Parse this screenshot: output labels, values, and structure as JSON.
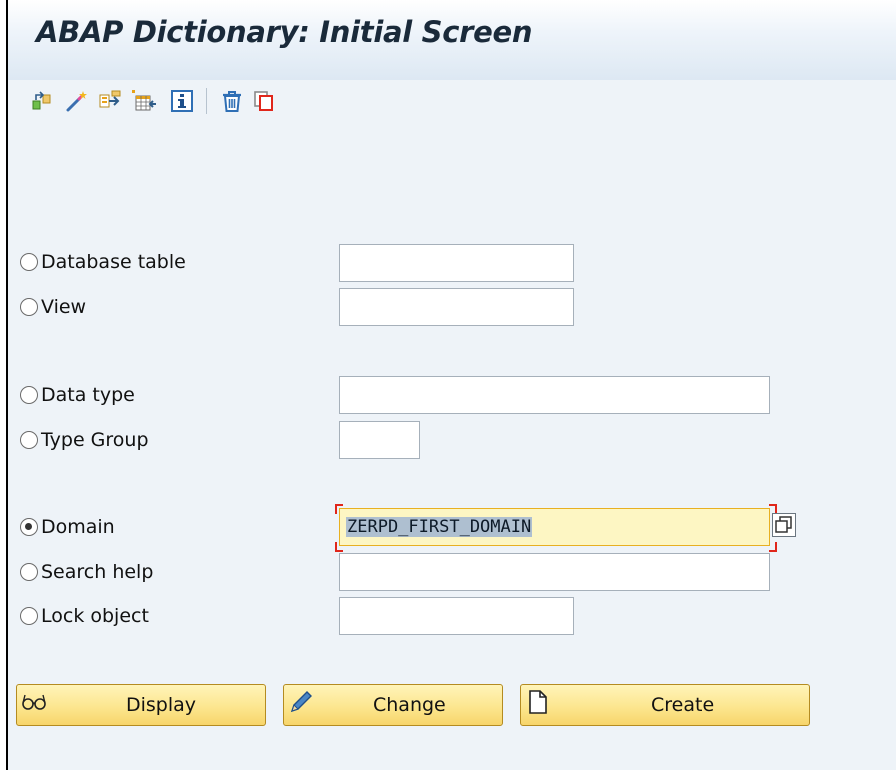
{
  "window": {
    "title": "ABAP Dictionary: Initial Screen"
  },
  "toolbar": {
    "icons": [
      "other-object-icon",
      "check-icon",
      "activate-icon",
      "where-used-icon",
      "info-icon",
      "delete-icon",
      "copy-icon"
    ]
  },
  "form": {
    "options": [
      {
        "label": "Database table",
        "value": "",
        "selected": false
      },
      {
        "label": "View",
        "value": "",
        "selected": false
      },
      {
        "label": "Data type",
        "value": "",
        "selected": false
      },
      {
        "label": "Type Group",
        "value": "",
        "selected": false
      },
      {
        "label": "Domain",
        "value": "ZERPD_FIRST_DOMAIN",
        "selected": true
      },
      {
        "label": "Search help",
        "value": "",
        "selected": false
      },
      {
        "label": "Lock object",
        "value": "",
        "selected": false
      }
    ]
  },
  "buttons": {
    "display_label": "Display",
    "change_label": "Change",
    "create_label": "Create"
  },
  "colors": {
    "background": "#eef3f8",
    "button_fill": "#fce68f",
    "active_field": "#fdf6c3",
    "focus_bracket": "#e0261b"
  }
}
